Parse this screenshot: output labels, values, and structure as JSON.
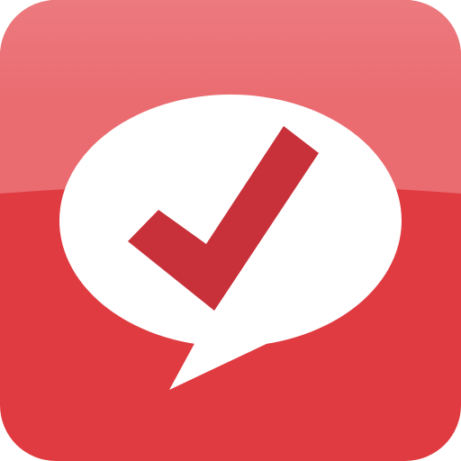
{
  "icon": {
    "name": "speech-bubble-checkmark-app-icon",
    "symbol": "checkmark-icon",
    "container": "speech-bubble-icon"
  },
  "colors": {
    "background_top": "#ea6b70",
    "background_bottom": "#df3b40",
    "bubble": "#ffffff",
    "checkmark": "#c8313a"
  }
}
